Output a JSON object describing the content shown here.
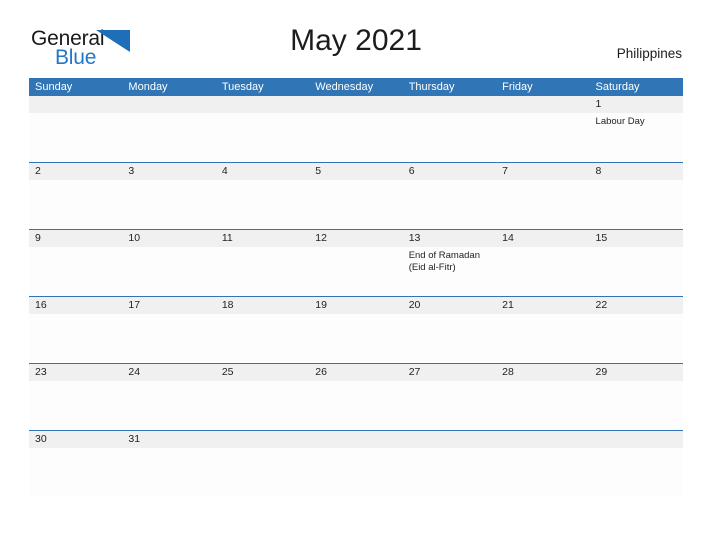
{
  "header": {
    "logo": {
      "word_one": "General",
      "word_two": "Blue",
      "mark_name": "blue-flag-triangle"
    },
    "title": "May 2021",
    "region": "Philippines"
  },
  "calendar": {
    "weekdays": [
      "Sunday",
      "Monday",
      "Tuesday",
      "Wednesday",
      "Thursday",
      "Friday",
      "Saturday"
    ],
    "accent_color": "#3075b5",
    "band_color": "#f0f0f0",
    "weeks": [
      {
        "days": [
          {
            "date": "",
            "events": []
          },
          {
            "date": "",
            "events": []
          },
          {
            "date": "",
            "events": []
          },
          {
            "date": "",
            "events": []
          },
          {
            "date": "",
            "events": []
          },
          {
            "date": "",
            "events": []
          },
          {
            "date": "1",
            "events": [
              "Labour Day"
            ]
          }
        ]
      },
      {
        "days": [
          {
            "date": "2",
            "events": []
          },
          {
            "date": "3",
            "events": []
          },
          {
            "date": "4",
            "events": []
          },
          {
            "date": "5",
            "events": []
          },
          {
            "date": "6",
            "events": []
          },
          {
            "date": "7",
            "events": []
          },
          {
            "date": "8",
            "events": []
          }
        ]
      },
      {
        "days": [
          {
            "date": "9",
            "events": []
          },
          {
            "date": "10",
            "events": []
          },
          {
            "date": "11",
            "events": []
          },
          {
            "date": "12",
            "events": []
          },
          {
            "date": "13",
            "events": [
              "End of Ramadan",
              "(Eid al-Fitr)"
            ]
          },
          {
            "date": "14",
            "events": []
          },
          {
            "date": "15",
            "events": []
          }
        ]
      },
      {
        "days": [
          {
            "date": "16",
            "events": []
          },
          {
            "date": "17",
            "events": []
          },
          {
            "date": "18",
            "events": []
          },
          {
            "date": "19",
            "events": []
          },
          {
            "date": "20",
            "events": []
          },
          {
            "date": "21",
            "events": []
          },
          {
            "date": "22",
            "events": []
          }
        ]
      },
      {
        "days": [
          {
            "date": "23",
            "events": []
          },
          {
            "date": "24",
            "events": []
          },
          {
            "date": "25",
            "events": []
          },
          {
            "date": "26",
            "events": []
          },
          {
            "date": "27",
            "events": []
          },
          {
            "date": "28",
            "events": []
          },
          {
            "date": "29",
            "events": []
          }
        ]
      },
      {
        "days": [
          {
            "date": "30",
            "events": []
          },
          {
            "date": "31",
            "events": []
          },
          {
            "date": "",
            "events": []
          },
          {
            "date": "",
            "events": []
          },
          {
            "date": "",
            "events": []
          },
          {
            "date": "",
            "events": []
          },
          {
            "date": "",
            "events": []
          }
        ]
      }
    ]
  }
}
